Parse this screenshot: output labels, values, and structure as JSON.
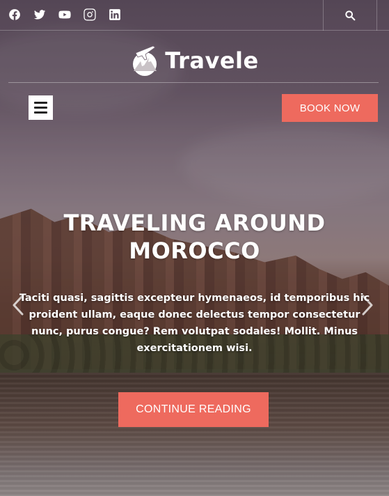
{
  "topbar": {
    "social_icons": [
      "facebook-icon",
      "twitter-icon",
      "youtube-icon",
      "instagram-icon",
      "linkedin-icon"
    ],
    "search_icon": "search-icon"
  },
  "header": {
    "logo_text": "Travele",
    "menu_icon": "hamburger-menu-icon",
    "book_button": "BOOK NOW"
  },
  "slide": {
    "title_line1": "TRAVELING AROUND",
    "title_line2": "MOROCCO",
    "excerpt": "Taciti quasi, sagittis excepteur hymenaeos, id temporibus hic proident ullam, eaque donec delectus tempor consectetur nunc, purus congue? Rem volutpat sodales! Mollit. Minus exercitationem wisi.",
    "cta": "CONTINUE READING",
    "prev_icon": "chevron-left-icon",
    "next_icon": "chevron-right-icon"
  },
  "colors": {
    "accent": "#ee6a5e",
    "text": "#ffffff"
  }
}
